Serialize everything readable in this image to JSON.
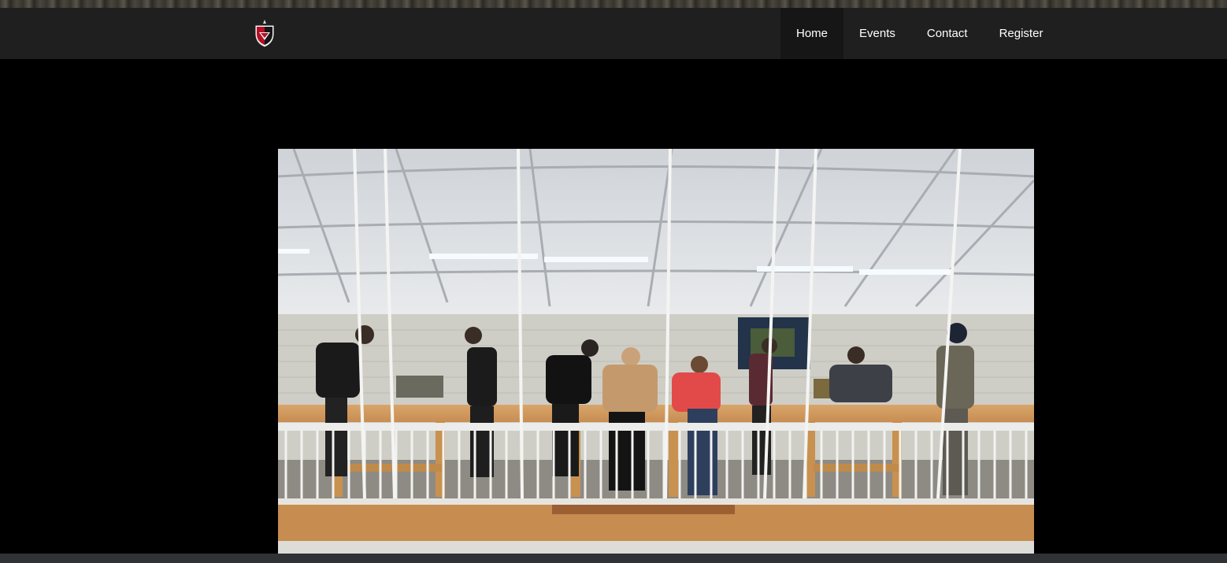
{
  "nav": {
    "items": [
      {
        "label": "Home",
        "active": true
      },
      {
        "label": "Events",
        "active": false
      },
      {
        "label": "Contact",
        "active": false
      },
      {
        "label": "Register",
        "active": false
      }
    ]
  },
  "logo": {
    "icon": "shield-logo-icon",
    "colors": [
      "#c8102e",
      "#111111",
      "#ffffff"
    ]
  },
  "hero": {
    "icon": "hall-photo"
  },
  "colors": {
    "navbar": "#1f1f1f",
    "page_background": "#000000",
    "nav_text": "#ffffff"
  }
}
